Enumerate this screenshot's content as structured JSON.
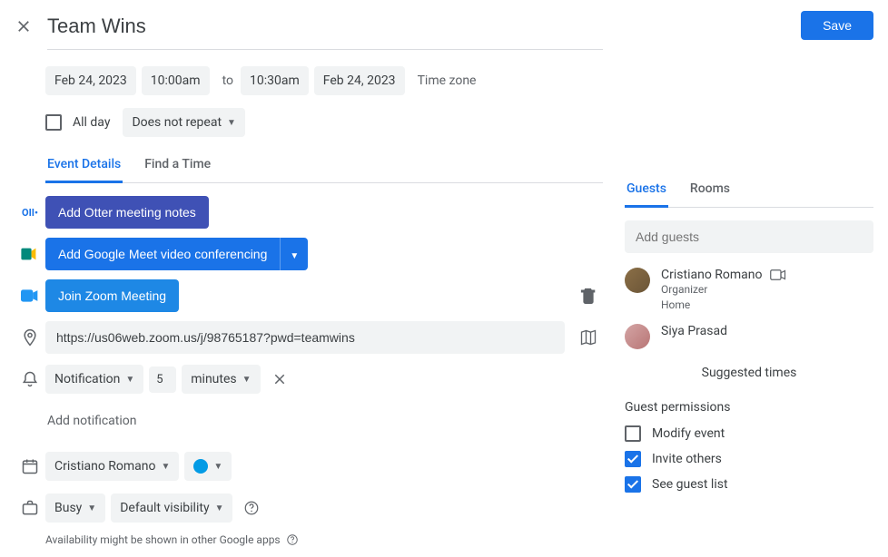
{
  "header": {
    "title": "Team Wins",
    "save": "Save"
  },
  "datetime": {
    "startDate": "Feb 24, 2023",
    "startTime": "10:00am",
    "to": "to",
    "endTime": "10:30am",
    "endDate": "Feb 24, 2023",
    "timezone": "Time zone",
    "allDay": "All day",
    "repeat": "Does not repeat"
  },
  "tabs": {
    "details": "Event Details",
    "findTime": "Find a Time"
  },
  "actions": {
    "otterNotes": "Add Otter meeting notes",
    "googleMeet": "Add Google Meet video conferencing",
    "joinZoom": "Join Zoom Meeting"
  },
  "location": {
    "url": "https://us06web.zoom.us/j/98765187?pwd=teamwins"
  },
  "notification": {
    "type": "Notification",
    "value": "5",
    "unit": "minutes",
    "add": "Add notification"
  },
  "calendar": {
    "owner": "Cristiano Romano"
  },
  "availability": {
    "busy": "Busy",
    "visibility": "Default visibility",
    "note": "Availability might be shown in other Google apps"
  },
  "rightTabs": {
    "guests": "Guests",
    "rooms": "Rooms"
  },
  "guests": {
    "placeholder": "Add guests",
    "list": [
      {
        "name": "Cristiano Romano",
        "role": "Organizer",
        "home": "Home",
        "hasCam": true
      },
      {
        "name": "Siya Prasad",
        "role": "",
        "home": "",
        "hasCam": false
      }
    ],
    "suggested": "Suggested times"
  },
  "permissions": {
    "title": "Guest permissions",
    "modify": "Modify event",
    "invite": "Invite others",
    "seeList": "See guest list"
  }
}
